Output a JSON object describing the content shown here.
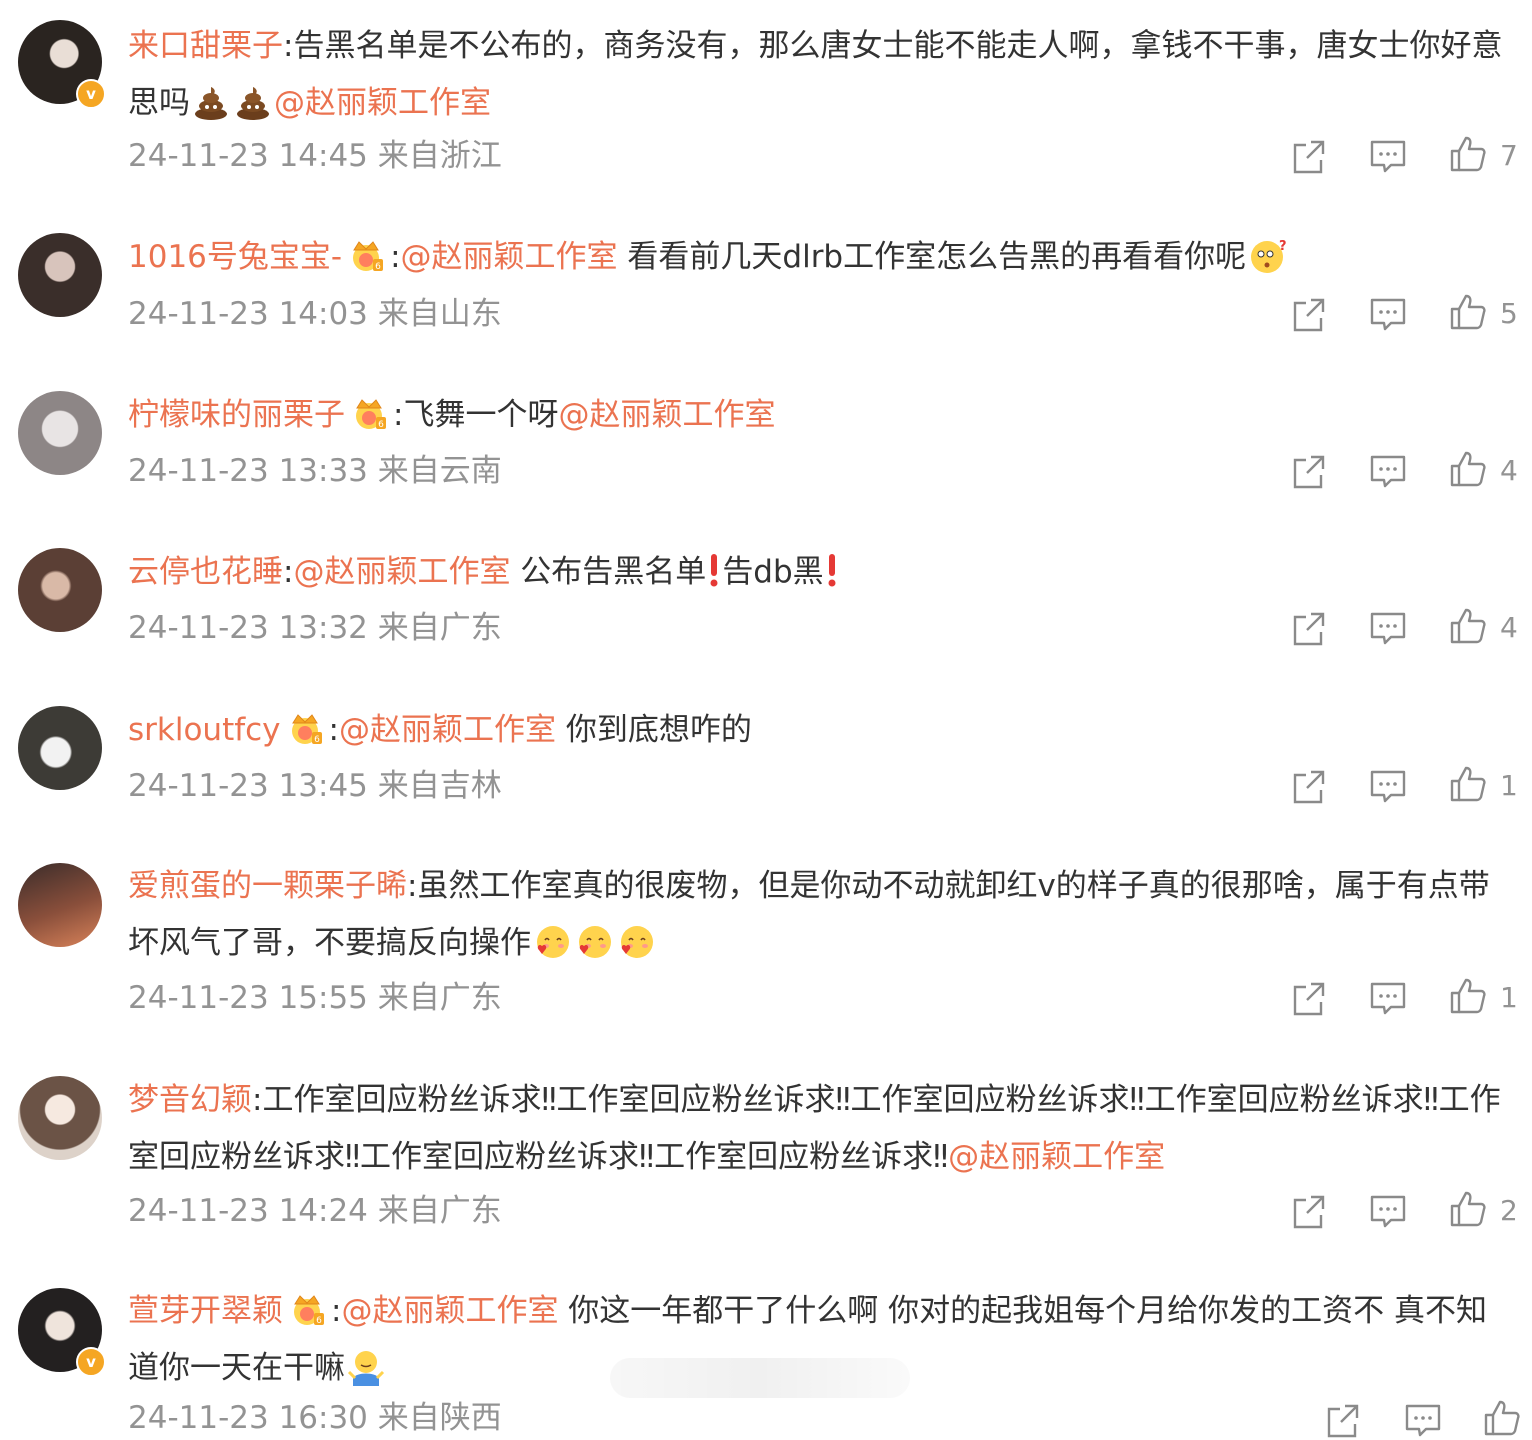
{
  "colors": {
    "accent": "#eb7350",
    "meta": "#939393",
    "text": "#333333",
    "badge": "#f5a623"
  },
  "icons": {
    "share": "share-icon",
    "comment": "comment-icon",
    "like": "like-icon",
    "crown": "crown-badge-icon",
    "verified": "verified-badge-icon"
  },
  "comments": [
    {
      "username": "来口甜栗子",
      "pre": ":告黑名单是不公布的，商务没有，那么唐女士能不能走人啊，拿钱不干事，唐女士你好意思吗",
      "mention": "@赵丽颖工作室",
      "post": "",
      "emoji": "poop",
      "meta": "24-11-23 14:45 来自浙江",
      "likes": "7"
    },
    {
      "username": "1016号兔宝宝-",
      "pre": ":",
      "mention": "@赵丽颖工作室",
      "post": " 看看前几天dlrb工作室怎么告黑的再看看你呢",
      "emoji": "confused",
      "meta": "24-11-23 14:03 来自山东",
      "likes": "5"
    },
    {
      "username": "柠檬味的丽栗子",
      "pre": ":飞舞一个呀",
      "mention": "@赵丽颖工作室",
      "post": "",
      "meta": "24-11-23 13:33 来自云南",
      "likes": "4"
    },
    {
      "username": "云停也花睡",
      "pre": ":",
      "mention": "@赵丽颖工作室",
      "post_a": " 公布告黑名单",
      "post_b": "告db黑",
      "meta": "24-11-23 13:32 来自广东",
      "likes": "4"
    },
    {
      "username": "srkloutfcy",
      "pre": ":",
      "mention": "@赵丽颖工作室",
      "post": " 你到底想咋的",
      "meta": "24-11-23 13:45 来自吉林",
      "likes": "1"
    },
    {
      "username": "爱煎蛋的一颗栗子晞",
      "pre": ":虽然工作室真的很废物，但是你动不动就卸红v的样子真的很那啥，属于有点带坏风气了哥，不要搞反向操作",
      "mention": "",
      "post": "",
      "emoji": "love",
      "meta": "24-11-23 15:55 来自广东",
      "likes": "1"
    },
    {
      "username": "梦音幻颖",
      "pre": ":工作室回应粉丝诉求‼工作室回应粉丝诉求‼工作室回应粉丝诉求‼工作室回应粉丝诉求‼工作室回应粉丝诉求‼工作室回应粉丝诉求‼工作室回应粉丝诉求‼",
      "mention": "@赵丽颖工作室",
      "post": "",
      "meta": "24-11-23 14:24 来自广东",
      "likes": "2"
    },
    {
      "username": "萱芽开翠颖",
      "pre": ":",
      "mention": "@赵丽颖工作室",
      "post": " 你这一年都干了什么啊 你对的起我姐每个月给你发的工资不 真不知道你一天在干嘛",
      "emoji": "shrug",
      "meta": "24-11-23 16:30 来自陕西",
      "likes": ""
    }
  ]
}
